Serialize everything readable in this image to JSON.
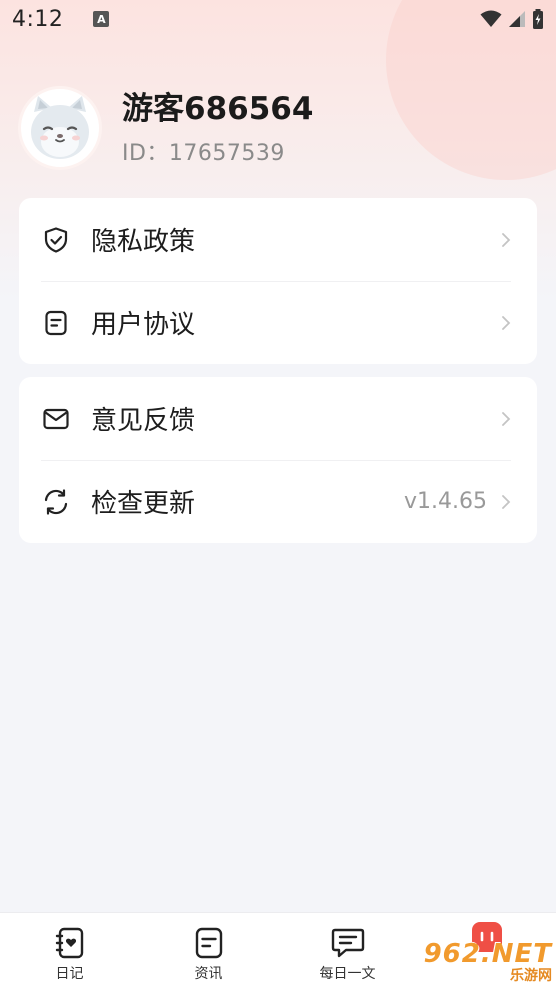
{
  "status_bar": {
    "time": "4:12",
    "notification_icon": "A"
  },
  "profile": {
    "nickname": "游客686564",
    "user_id": "ID：17657539",
    "avatar_icon": "cat-avatar-icon"
  },
  "menu_group_1": [
    {
      "label": "隐私政策",
      "icon": "shield-check-icon"
    },
    {
      "label": "用户协议",
      "icon": "document-icon"
    }
  ],
  "menu_group_2": [
    {
      "label": "意见反馈",
      "icon": "mail-icon"
    },
    {
      "label": "检查更新",
      "icon": "refresh-icon",
      "value": "v1.4.65"
    }
  ],
  "bottom_nav": [
    {
      "label": "日记",
      "icon": "diary-icon"
    },
    {
      "label": "资讯",
      "icon": "news-icon"
    },
    {
      "label": "每日一文",
      "icon": "chat-icon"
    },
    {
      "label": "",
      "icon": "profile-icon"
    }
  ],
  "watermark": {
    "logo": "962.NET",
    "sub": "乐游网"
  },
  "colors": {
    "accent": "#ef4f45",
    "background": "#f4f5f9",
    "card": "#ffffff"
  }
}
